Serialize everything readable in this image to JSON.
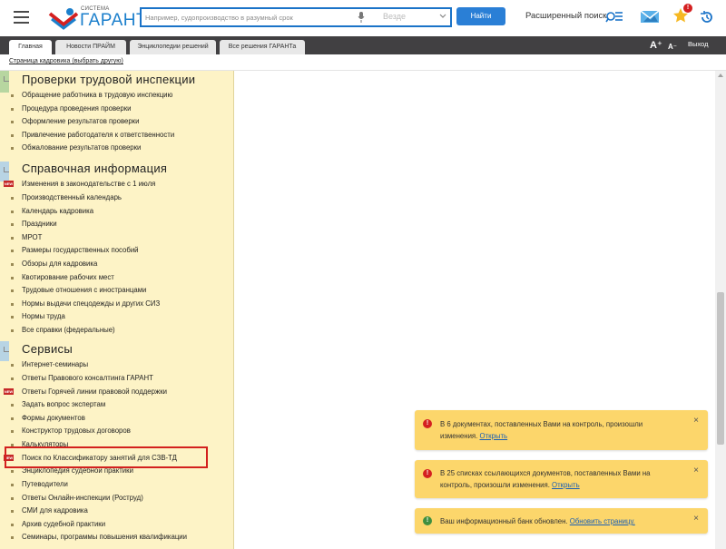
{
  "header": {
    "logo_small": "СИСТЕМА",
    "logo_main": "ГАРАНТ",
    "search_placeholder": "Например, судопроизводство в разумный срок",
    "search_scope": "Везде",
    "find_label": "Найти",
    "advanced_search_label": "Расширенный поиск",
    "favorites_badge": "!"
  },
  "tabs": [
    {
      "label": "Главная",
      "active": true
    },
    {
      "label": "Новости ПРАЙМ",
      "active": false
    },
    {
      "label": "Энциклопедии решений",
      "active": false
    },
    {
      "label": "Все решения ГАРАНТа",
      "active": false
    }
  ],
  "font_controls": {
    "bigger": "A⁺",
    "smaller": "A⁻"
  },
  "exit_label": "Выход",
  "breadcrumb": "Страница кадровика (выбрать другую)",
  "sections": [
    {
      "title": "Проверки трудовой инспекции",
      "items": [
        {
          "label": "Обращение работника в трудовую инспекцию",
          "new": false
        },
        {
          "label": "Процедура проведения проверки",
          "new": false
        },
        {
          "label": "Оформление результатов проверки",
          "new": false
        },
        {
          "label": "Привлечение работодателя к ответственности",
          "new": false
        },
        {
          "label": "Обжалование результатов проверки",
          "new": false
        }
      ]
    },
    {
      "title": "Справочная информация",
      "items": [
        {
          "label": "Изменения в законодательстве с 1 июля",
          "new": true
        },
        {
          "label": "Производственный календарь",
          "new": false
        },
        {
          "label": "Календарь кадровика",
          "new": false
        },
        {
          "label": "Праздники",
          "new": false
        },
        {
          "label": "МРОТ",
          "new": false
        },
        {
          "label": "Размеры государственных пособий",
          "new": false
        },
        {
          "label": "Обзоры для кадровика",
          "new": false
        },
        {
          "label": "Квотирование рабочих мест",
          "new": false
        },
        {
          "label": "Трудовые отношения с иностранцами",
          "new": false
        },
        {
          "label": "Нормы выдачи спецодежды и других СИЗ",
          "new": false
        },
        {
          "label": "Нормы труда",
          "new": false
        },
        {
          "label": "Все справки (федеральные)",
          "new": false
        }
      ]
    },
    {
      "title": "Сервисы",
      "items": [
        {
          "label": "Интернет-семинары",
          "new": false
        },
        {
          "label": "Ответы Правового консалтинга ГАРАНТ",
          "new": false
        },
        {
          "label": "Ответы Горячей линии правовой поддержки",
          "new": true
        },
        {
          "label": "Задать вопрос экспертам",
          "new": false
        },
        {
          "label": "Формы документов",
          "new": false
        },
        {
          "label": "Конструктор трудовых договоров",
          "new": false
        },
        {
          "label": "Калькуляторы",
          "new": false
        },
        {
          "label": "Поиск по Классификатору занятий для СЗВ-ТД",
          "new": true
        },
        {
          "label": "Энциклопедия судебной практики",
          "new": false
        },
        {
          "label": "Путеводители",
          "new": false
        },
        {
          "label": "Ответы Онлайн-инспекции (Роструд)",
          "new": false
        },
        {
          "label": "СМИ для кадровика",
          "new": false
        },
        {
          "label": "Архив судебной практики",
          "new": false
        },
        {
          "label": "Семинары, программы повышения квалификации",
          "new": false
        }
      ]
    }
  ],
  "notifications": [
    {
      "type": "error",
      "text": "В 6 документах, поставленных Вами на контроль, произошли изменения.",
      "link": "Открыть"
    },
    {
      "type": "error",
      "text": "В 25 списках ссылающихся документов, поставленных Вами на контроль, произошли изменения.",
      "link": "Открыть"
    },
    {
      "type": "success",
      "text": "Ваш информационный банк обновлен.",
      "link": "Обновить страницу."
    }
  ],
  "notif_icons": {
    "error": "!",
    "success": "!"
  },
  "close_glyph": "×",
  "colors": {
    "accent_blue": "#1a73c8",
    "panel_bg": "#fdf3c6",
    "notif_bg": "#fcd66b",
    "error_red": "#d42020",
    "success_green": "#3f8f3f",
    "highlight": "#d3201e"
  }
}
